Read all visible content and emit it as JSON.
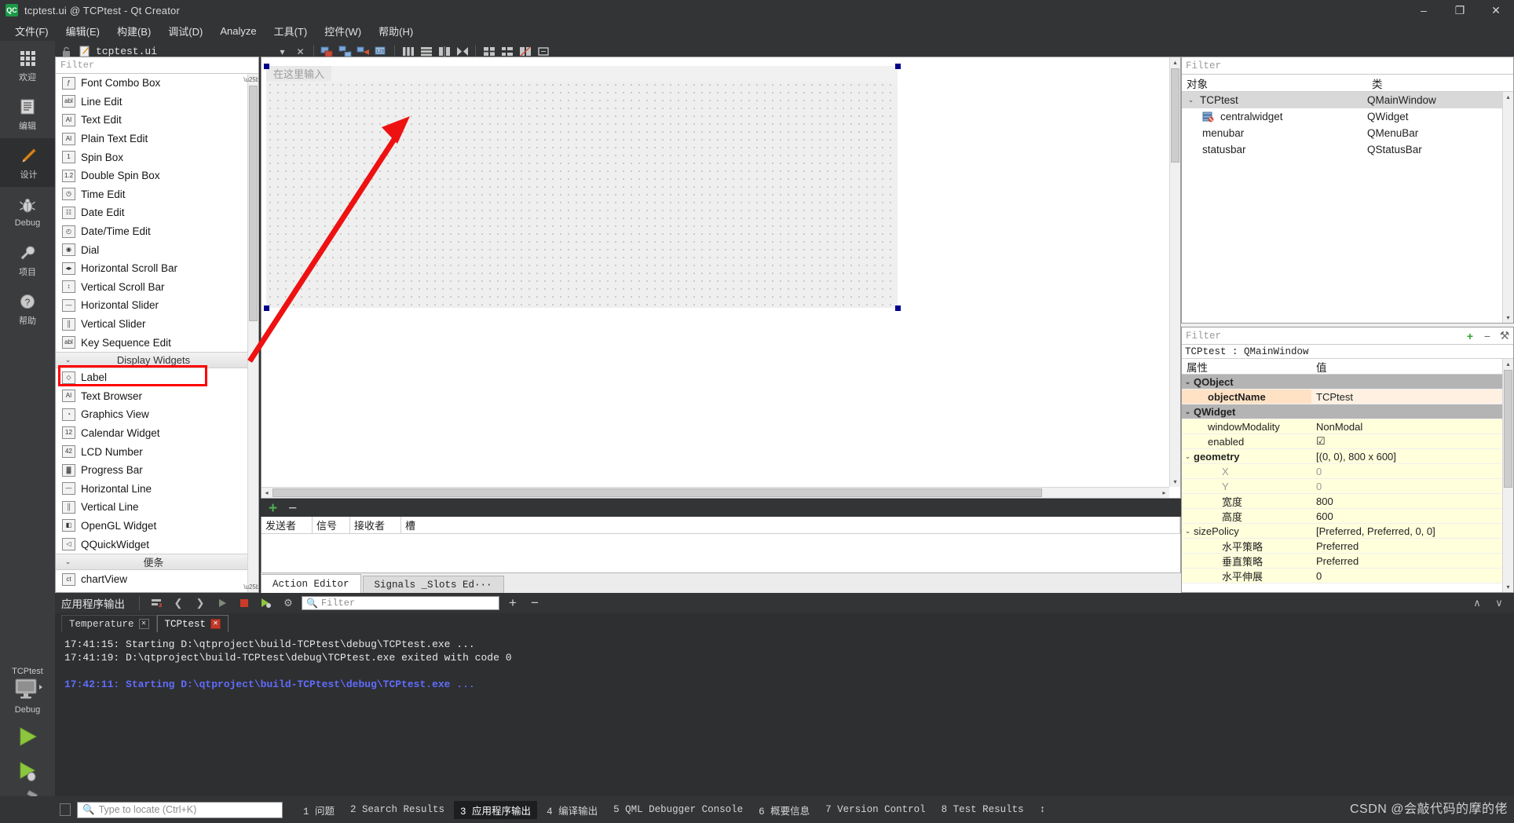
{
  "window": {
    "title": "tcptest.ui @ TCPtest - Qt Creator",
    "logo_text": "QC",
    "minimize": "–",
    "maximize": "❐",
    "close": "✕"
  },
  "menubar": {
    "items": [
      {
        "label": "文件(F)"
      },
      {
        "label": "编辑(E)"
      },
      {
        "label": "构建(B)"
      },
      {
        "label": "调试(D)"
      },
      {
        "label": "Analyze"
      },
      {
        "label": "工具(T)"
      },
      {
        "label": "控件(W)"
      },
      {
        "label": "帮助(H)"
      }
    ]
  },
  "mode_rail": {
    "items": [
      {
        "label": "欢迎",
        "icon": "grid-icon",
        "active": false
      },
      {
        "label": "编辑",
        "icon": "document-icon",
        "active": false
      },
      {
        "label": "设计",
        "icon": "pencil-icon",
        "active": true
      },
      {
        "label": "Debug",
        "icon": "bug-icon",
        "active": false
      },
      {
        "label": "项目",
        "icon": "wrench-icon",
        "active": false
      },
      {
        "label": "帮助",
        "icon": "question-icon",
        "active": false
      }
    ],
    "kit_name": "TCPtest",
    "kit_build": "Debug",
    "run_label": "run-button",
    "debug_label": "debug-button",
    "build_label": "build-button"
  },
  "doc_toolbar": {
    "filename": "tcptest.ui",
    "dropdown": "▾",
    "close": "✕",
    "icons": [
      "edit-widgets-icon",
      "edit-signals-slots-icon",
      "edit-buddies-icon",
      "edit-tab-order-icon",
      "layout-horizontal-icon",
      "layout-vertical-icon",
      "layout-splitter-h-icon",
      "layout-splitter-v-icon",
      "layout-grid-icon",
      "layout-form-icon",
      "break-layout-icon",
      "adjust-size-icon"
    ]
  },
  "widget_box": {
    "filter_placeholder": "Filter",
    "items": [
      {
        "label": "Font Combo Box",
        "icon": "font-combo-icon",
        "glyph": "ƒ",
        "type": "item"
      },
      {
        "label": "Line Edit",
        "icon": "line-edit-icon",
        "glyph": "abl",
        "type": "item"
      },
      {
        "label": "Text Edit",
        "icon": "text-edit-icon",
        "glyph": "AI",
        "type": "item"
      },
      {
        "label": "Plain Text Edit",
        "icon": "plain-text-edit-icon",
        "glyph": "AI",
        "type": "item"
      },
      {
        "label": "Spin Box",
        "icon": "spin-box-icon",
        "glyph": "1",
        "type": "item"
      },
      {
        "label": "Double Spin Box",
        "icon": "double-spin-box-icon",
        "glyph": "1.2",
        "type": "item"
      },
      {
        "label": "Time Edit",
        "icon": "time-edit-icon",
        "glyph": "◷",
        "type": "item"
      },
      {
        "label": "Date Edit",
        "icon": "date-edit-icon",
        "glyph": "☷",
        "type": "item"
      },
      {
        "label": "Date/Time Edit",
        "icon": "date-time-edit-icon",
        "glyph": "◴",
        "type": "item"
      },
      {
        "label": "Dial",
        "icon": "dial-icon",
        "glyph": "◉",
        "type": "item"
      },
      {
        "label": "Horizontal Scroll Bar",
        "icon": "h-scrollbar-icon",
        "glyph": "◂▸",
        "type": "item"
      },
      {
        "label": "Vertical Scroll Bar",
        "icon": "v-scrollbar-icon",
        "glyph": "↕",
        "type": "item"
      },
      {
        "label": "Horizontal Slider",
        "icon": "h-slider-icon",
        "glyph": "—",
        "type": "item"
      },
      {
        "label": "Vertical Slider",
        "icon": "v-slider-icon",
        "glyph": "║",
        "type": "item"
      },
      {
        "label": "Key Sequence Edit",
        "icon": "key-sequence-edit-icon",
        "glyph": "abl",
        "type": "item"
      },
      {
        "label": "Display Widgets",
        "icon": "group-collapse-icon",
        "glyph": "⌄",
        "type": "group"
      },
      {
        "label": "Label",
        "icon": "label-icon",
        "glyph": "◇",
        "type": "item",
        "highlighted": true
      },
      {
        "label": "Text Browser",
        "icon": "text-browser-icon",
        "glyph": "AI",
        "type": "item"
      },
      {
        "label": "Graphics View",
        "icon": "graphics-view-icon",
        "glyph": "◔",
        "type": "item"
      },
      {
        "label": "Calendar Widget",
        "icon": "calendar-widget-icon",
        "glyph": "12",
        "type": "item"
      },
      {
        "label": "LCD Number",
        "icon": "lcd-number-icon",
        "glyph": "42",
        "type": "item"
      },
      {
        "label": "Progress Bar",
        "icon": "progress-bar-icon",
        "glyph": "▓",
        "type": "item"
      },
      {
        "label": "Horizontal Line",
        "icon": "h-line-icon",
        "glyph": "—",
        "type": "item"
      },
      {
        "label": "Vertical Line",
        "icon": "v-line-icon",
        "glyph": "║",
        "type": "item"
      },
      {
        "label": "OpenGL Widget",
        "icon": "opengl-widget-icon",
        "glyph": "◧",
        "type": "item"
      },
      {
        "label": "QQuickWidget",
        "icon": "qquick-widget-icon",
        "glyph": "◁",
        "type": "item"
      },
      {
        "label": "便条",
        "icon": "group-collapse-icon",
        "glyph": "⌄",
        "type": "group"
      },
      {
        "label": "chartView",
        "icon": "chartview-icon",
        "glyph": "ct",
        "type": "item"
      }
    ]
  },
  "form_editor": {
    "menu_placeholder": "在这里输入"
  },
  "signal_slot_editor": {
    "add_label": "+",
    "remove_label": "−",
    "columns": [
      "发送者",
      "信号",
      "接收者",
      "槽"
    ],
    "tabs": [
      {
        "label": "Action Editor",
        "active": true
      },
      {
        "label": "Signals _Slots Ed···",
        "active": false
      }
    ]
  },
  "object_inspector": {
    "filter_placeholder": "Filter",
    "columns": [
      "对象",
      "类"
    ],
    "rows": [
      {
        "name": "TCPtest",
        "class": "QMainWindow",
        "indent": 0,
        "expander": "⌄",
        "selected": true,
        "icon": ""
      },
      {
        "name": "centralwidget",
        "class": "QWidget",
        "indent": 1,
        "expander": "",
        "selected": false,
        "icon": "central-widget-icon"
      },
      {
        "name": "menubar",
        "class": "QMenuBar",
        "indent": 1,
        "expander": "",
        "selected": false,
        "icon": ""
      },
      {
        "name": "statusbar",
        "class": "QStatusBar",
        "indent": 1,
        "expander": "",
        "selected": false,
        "icon": ""
      }
    ]
  },
  "property_editor": {
    "filter_placeholder": "Filter",
    "add_label": "+",
    "remove_label": "−",
    "config_label": "⚒",
    "object_header": "TCPtest : QMainWindow",
    "columns": [
      "属性",
      "值"
    ],
    "rows": [
      {
        "name": "QObject",
        "value": "",
        "kind": "group",
        "indent": 0,
        "expander": "⌄"
      },
      {
        "name": "objectName",
        "value": "TCPtest",
        "kind": "peach",
        "indent": 1,
        "expander": "",
        "bold": true
      },
      {
        "name": "QWidget",
        "value": "",
        "kind": "group",
        "indent": 0,
        "expander": "⌄"
      },
      {
        "name": "windowModality",
        "value": "NonModal",
        "kind": "yellow",
        "indent": 1,
        "expander": ""
      },
      {
        "name": "enabled",
        "value": "☑",
        "kind": "yellow",
        "indent": 1,
        "expander": ""
      },
      {
        "name": "geometry",
        "value": "[(0, 0), 800 x 600]",
        "kind": "yellow",
        "indent": 0,
        "expander": "⌄",
        "bold": true
      },
      {
        "name": "X",
        "value": "0",
        "kind": "yellow",
        "indent": 2,
        "expander": "",
        "grey": true
      },
      {
        "name": "Y",
        "value": "0",
        "kind": "yellow",
        "indent": 2,
        "expander": "",
        "grey": true
      },
      {
        "name": "宽度",
        "value": "800",
        "kind": "yellow",
        "indent": 2,
        "expander": ""
      },
      {
        "name": "高度",
        "value": "600",
        "kind": "yellow",
        "indent": 2,
        "expander": ""
      },
      {
        "name": "sizePolicy",
        "value": "[Preferred, Preferred, 0, 0]",
        "kind": "yellow",
        "indent": 0,
        "expander": "⌄"
      },
      {
        "name": "水平策略",
        "value": "Preferred",
        "kind": "yellow",
        "indent": 2,
        "expander": ""
      },
      {
        "name": "垂直策略",
        "value": "Preferred",
        "kind": "yellow",
        "indent": 2,
        "expander": ""
      },
      {
        "name": "水平伸展",
        "value": "0",
        "kind": "yellow",
        "indent": 2,
        "expander": ""
      }
    ]
  },
  "output_pane": {
    "title": "应用程序输出",
    "filter_placeholder": "Filter",
    "toolbar_icons": [
      "word-wrap-icon",
      "prev-item-icon",
      "next-item-icon",
      "run-icon",
      "stop-icon",
      "attach-debugger-icon",
      "settings-icon"
    ],
    "zoom_in": "+",
    "zoom_out": "−",
    "minimize": "∧",
    "maximize": "∨",
    "tabs": [
      {
        "label": "Temperature",
        "active": false,
        "close_red": false
      },
      {
        "label": "TCPtest",
        "active": true,
        "close_red": true
      }
    ],
    "lines": [
      {
        "text": "17:41:15: Starting D:\\qtproject\\build-TCPtest\\debug\\TCPtest.exe ...",
        "highlight": false
      },
      {
        "text": "17:41:19: D:\\qtproject\\build-TCPtest\\debug\\TCPtest.exe exited with code 0",
        "highlight": false
      },
      {
        "text": "",
        "highlight": false
      },
      {
        "text": "17:42:11: Starting D:\\qtproject\\build-TCPtest\\debug\\TCPtest.exe ...",
        "highlight": true
      }
    ]
  },
  "statusbar": {
    "locate_placeholder": "Type to locate (Ctrl+K)",
    "items": [
      {
        "label": "1 问题",
        "active": false
      },
      {
        "label": "2 Search Results",
        "active": false
      },
      {
        "label": "3 应用程序输出",
        "active": true
      },
      {
        "label": "4 编译输出",
        "active": false
      },
      {
        "label": "5 QML Debugger Console",
        "active": false
      },
      {
        "label": "6 概要信息",
        "active": false
      },
      {
        "label": "7 Version Control",
        "active": false
      },
      {
        "label": "8 Test Results",
        "active": false
      }
    ],
    "updown": "↕"
  },
  "watermark": {
    "text": "CSDN @会敲代码的摩的佬"
  },
  "colors": {
    "chrome_dark": "#333436",
    "rail": "#3b3c3e",
    "accent_red": "#ff0000",
    "log_blue": "#5f6cff",
    "property_yellow": "#ffffdc",
    "property_peach": "#ffe2c4"
  }
}
